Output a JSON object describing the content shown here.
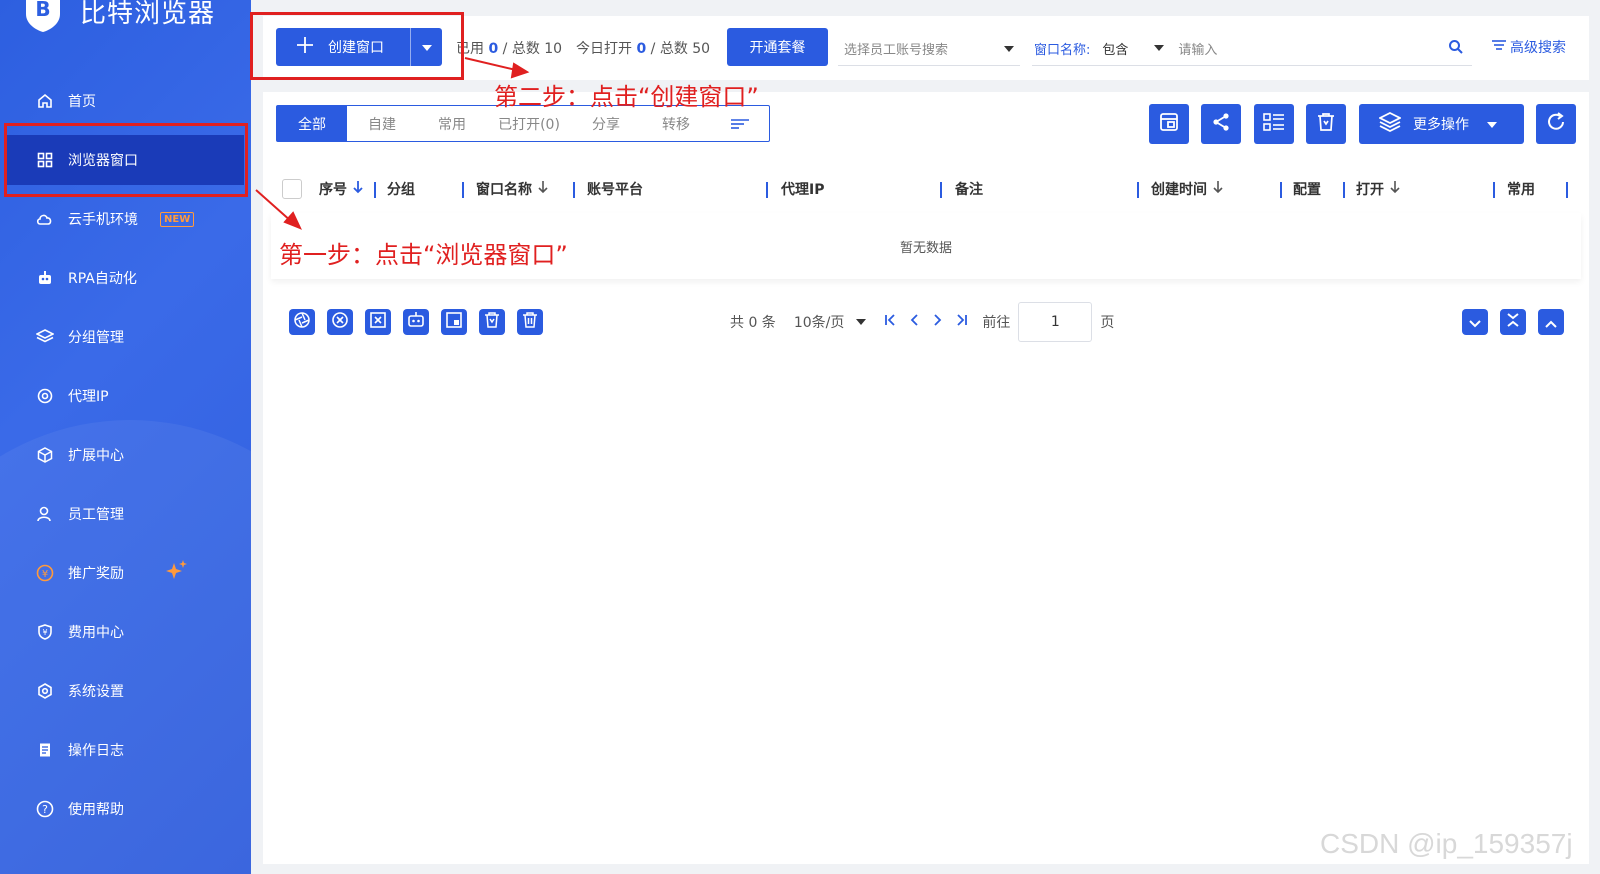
{
  "app": {
    "title": "比特浏览器"
  },
  "sidebar": {
    "items": [
      {
        "label": "首页",
        "icon": "home-icon"
      },
      {
        "label": "浏览器窗口",
        "icon": "grid-icon",
        "active": true
      },
      {
        "label": "云手机环境",
        "icon": "cloud-icon",
        "badge": "NEW"
      },
      {
        "label": "RPA自动化",
        "icon": "robot-icon"
      },
      {
        "label": "分组管理",
        "icon": "layers-icon"
      },
      {
        "label": "代理IP",
        "icon": "location-icon"
      },
      {
        "label": "扩展中心",
        "icon": "cube-icon"
      },
      {
        "label": "员工管理",
        "icon": "users-icon"
      },
      {
        "label": "推广奖励",
        "icon": "yen-icon"
      },
      {
        "label": "费用中心",
        "icon": "shield-yen-icon"
      },
      {
        "label": "系统设置",
        "icon": "settings-icon"
      },
      {
        "label": "操作日志",
        "icon": "log-icon"
      },
      {
        "label": "使用帮助",
        "icon": "help-icon"
      }
    ]
  },
  "toolbar": {
    "create_label": "创建窗口",
    "used_label": "已用",
    "used_value": "0",
    "total_label": "/ 总数 10",
    "today_label": "今日打开",
    "today_value": "0",
    "today_total": "/ 总数 50",
    "plan_label": "开通套餐",
    "staff_placeholder": "选择员工账号搜索",
    "search_field_label": "窗口名称:",
    "search_mode": "包含",
    "search_placeholder": "请输入",
    "advanced_label": "高级搜索"
  },
  "tabs": [
    "全部",
    "自建",
    "常用",
    "已打开(0)",
    "分享",
    "转移"
  ],
  "more_actions_label": "更多操作",
  "table": {
    "columns": [
      "序号",
      "分组",
      "窗口名称",
      "账号平台",
      "代理IP",
      "备注",
      "创建时间",
      "配置",
      "打开",
      "常用"
    ],
    "empty_text": "暂无数据"
  },
  "pager": {
    "total_text": "共 0 条",
    "page_size": "10条/页",
    "goto_label": "前往",
    "page_value": "1",
    "page_suffix": "页"
  },
  "annotations": {
    "step1": "第一步：点击“浏览器窗口”",
    "step2": "第二步：点击“创建窗口”"
  },
  "watermark": "CSDN @ip_159357j",
  "colors": {
    "primary": "#2b5be0",
    "annotation": "#e02020",
    "new_badge": "#ff9a3c"
  }
}
